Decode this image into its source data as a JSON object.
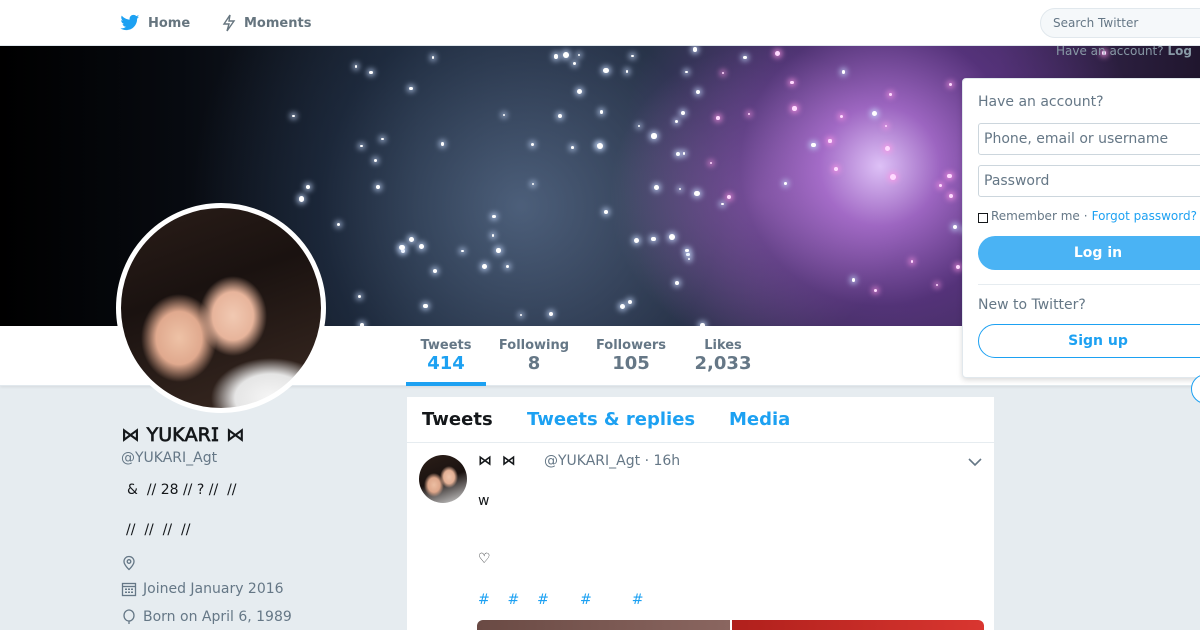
{
  "nav": {
    "home_label": "Home",
    "moments_label": "Moments",
    "search_placeholder": "Search Twitter",
    "have_account_text": "Have an account?",
    "login_link": "Log"
  },
  "profile": {
    "display_name": "⋈ 𝖸𝖴𝖪𝖠𝖱𝖨 ⋈",
    "handle": "@YUKARI_Agt",
    "bio_line1": "&  // 28 // ? //  //",
    "bio_line2": "//  //  //  //",
    "joined": "Joined January 2016",
    "born": "Born on April 6, 1989"
  },
  "stats": [
    {
      "label": "Tweets",
      "value": "414"
    },
    {
      "label": "Following",
      "value": "8"
    },
    {
      "label": "Followers",
      "value": "105"
    },
    {
      "label": "Likes",
      "value": "2,033"
    }
  ],
  "timeline": {
    "tabs": [
      "Tweets",
      "Tweets & replies",
      "Media"
    ]
  },
  "tweet": {
    "name": "⋈  ⋈",
    "handle_time": "@YUKARI_Agt · 16h",
    "text1": "w",
    "text2": "♡",
    "hashtags": "#    #    #       #         #"
  },
  "login": {
    "title": "Have an account?",
    "username_placeholder": "Phone, email or username",
    "password_placeholder": "Password",
    "remember": "Remember me",
    "separator": "·",
    "forgot": "Forgot password?",
    "login_button": "Log in",
    "new_prompt": "New to Twitter?",
    "signup_button": "Sign up"
  },
  "colors": {
    "accent": "#1da1f2",
    "background": "#e6ecf0"
  }
}
